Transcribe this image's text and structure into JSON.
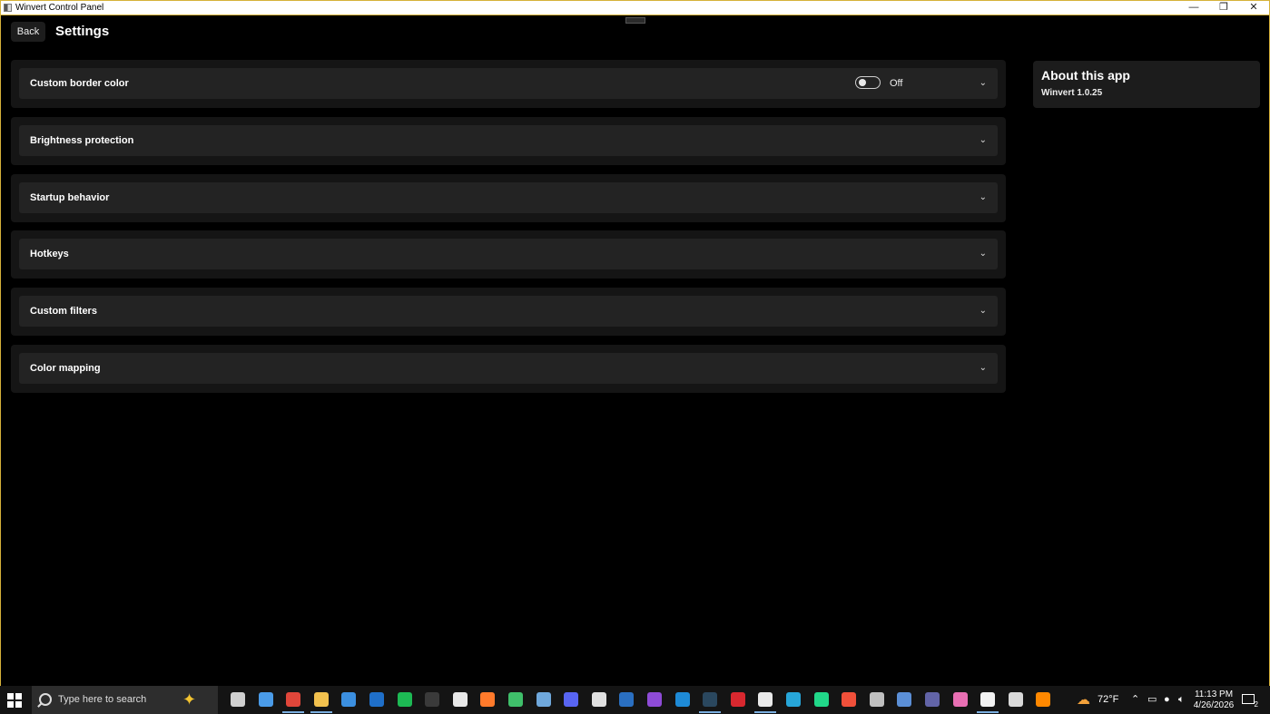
{
  "window": {
    "title": "Winvert Control Panel",
    "minimize": "—",
    "restore": "❐",
    "close": "✕",
    "accent_color": "#d6b23a"
  },
  "header": {
    "back_label": "Back",
    "page_title": "Settings"
  },
  "sections": [
    {
      "label": "Custom border color",
      "toggle_state": "Off"
    },
    {
      "label": "Brightness protection"
    },
    {
      "label": "Startup behavior"
    },
    {
      "label": "Hotkeys"
    },
    {
      "label": "Custom filters"
    },
    {
      "label": "Color mapping"
    }
  ],
  "chevron": "⌄",
  "about": {
    "heading": "About this app",
    "version": "Winvert 1.0.25"
  },
  "taskbar": {
    "search_placeholder": "Type here to search",
    "weather": "72°F",
    "time": "11:13 PM",
    "date": "4/26/2026",
    "notification_count": "2",
    "apps": [
      {
        "name": "task-view-icon",
        "color": "#cfcfcf"
      },
      {
        "name": "copilot-icon",
        "color": "#4a9be8"
      },
      {
        "name": "chrome-icon",
        "color": "#e0463a"
      },
      {
        "name": "file-explorer-icon",
        "color": "#f2c14e"
      },
      {
        "name": "store-icon",
        "color": "#3b8fe0"
      },
      {
        "name": "outlook-icon",
        "color": "#1f6fc9"
      },
      {
        "name": "spotify-icon",
        "color": "#1db954"
      },
      {
        "name": "terminal-icon",
        "color": "#3a3a3a"
      },
      {
        "name": "g-app-icon",
        "color": "#e8e8e8"
      },
      {
        "name": "firefox-icon",
        "color": "#ff7a2b"
      },
      {
        "name": "green-app-icon",
        "color": "#3fbf6a"
      },
      {
        "name": "network-tool-icon",
        "color": "#6fa8dc"
      },
      {
        "name": "discord-icon",
        "color": "#5865f2"
      },
      {
        "name": "books-icon",
        "color": "#e0e0e0"
      },
      {
        "name": "powershell-icon",
        "color": "#2a6fc1"
      },
      {
        "name": "visual-studio-icon",
        "color": "#8e4bd6"
      },
      {
        "name": "vscode-icon",
        "color": "#1e8ad6"
      },
      {
        "name": "steam-icon",
        "color": "#2a475e"
      },
      {
        "name": "red-app-icon",
        "color": "#d8282f"
      },
      {
        "name": "winvert-icon",
        "color": "#e9e9e9"
      },
      {
        "name": "link-app-icon",
        "color": "#27a6d9"
      },
      {
        "name": "pycharm-icon",
        "color": "#21d789"
      },
      {
        "name": "git-icon",
        "color": "#f0503a"
      },
      {
        "name": "mail-icon",
        "color": "#bfbfbf"
      },
      {
        "name": "editor-icon",
        "color": "#5b8fd6"
      },
      {
        "name": "teams-icon",
        "color": "#6264a7"
      },
      {
        "name": "paint-icon",
        "color": "#e86fb3"
      },
      {
        "name": "active-app-icon",
        "color": "#f2f2f2"
      },
      {
        "name": "media-player-icon",
        "color": "#d9d9d9"
      },
      {
        "name": "vlc-icon",
        "color": "#ff8800"
      }
    ]
  }
}
